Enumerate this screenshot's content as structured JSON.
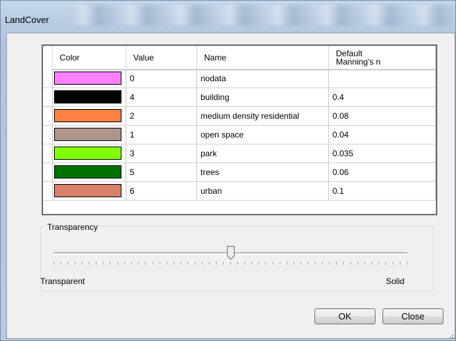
{
  "window": {
    "title": "LandCover"
  },
  "table": {
    "headers": [
      "Color",
      "Value",
      "Name",
      "Default Manning's n"
    ],
    "header_n_line1": "Default",
    "header_n_line2": "Manning's n",
    "rows": [
      {
        "color": "#ff80ff",
        "value": "0",
        "name": "nodata",
        "n": ""
      },
      {
        "color": "#000000",
        "value": "4",
        "name": "building",
        "n": "0.4"
      },
      {
        "color": "#ff8040",
        "value": "2",
        "name": "medium density residential",
        "n": "0.08"
      },
      {
        "color": "#b0958a",
        "value": "1",
        "name": "open space",
        "n": "0.04"
      },
      {
        "color": "#80ff00",
        "value": "3",
        "name": "park",
        "n": "0.035"
      },
      {
        "color": "#007300",
        "value": "5",
        "name": "trees",
        "n": "0.06"
      },
      {
        "color": "#d98068",
        "value": "6",
        "name": "urban",
        "n": "0.1"
      }
    ]
  },
  "transparency": {
    "group_label": "Transparency",
    "left_label": "Transparent",
    "right_label": "Solid",
    "slider_value_fraction": 0.5
  },
  "buttons": {
    "ok": "OK",
    "close": "Close"
  }
}
